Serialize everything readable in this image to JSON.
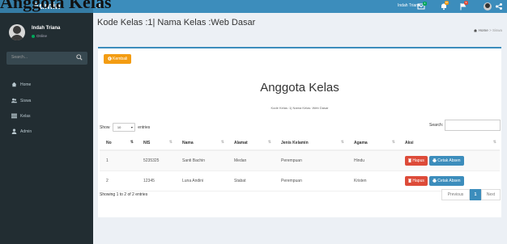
{
  "overlay_title": "Anggota Kelas",
  "sidebar": {
    "brand": "Admin",
    "user": {
      "name": "Indah Triana",
      "status": "Online"
    },
    "search": {
      "placeholder": "Search..."
    },
    "items": [
      {
        "label": "Home",
        "icon": "home-icon"
      },
      {
        "label": "Siswa",
        "icon": "users-icon"
      },
      {
        "label": "Kelas",
        "icon": "list-icon"
      },
      {
        "label": "Admin",
        "icon": "user-icon"
      }
    ]
  },
  "topbar": {
    "user_name": "Indah Triana",
    "icons": [
      "envelope-icon",
      "bell-icon",
      "flag-icon",
      "share-icon"
    ],
    "badges": {
      "envelope": "4",
      "bell": "10",
      "flag": "9"
    }
  },
  "header": {
    "title": "Kode Kelas :1| Nama Kelas :Web Dasar",
    "breadcrumb": [
      "Home",
      "Siswa"
    ]
  },
  "box": {
    "back_button": "Kembali",
    "title": "Anggota Kelas",
    "subtitle": "Kode Kelas :1| Nama Kelas :Web Dasar",
    "show_label": "Show",
    "entries_value": "10",
    "entries_label": "entries",
    "search_label": "Search:"
  },
  "table": {
    "columns": [
      "No",
      "NIS",
      "Nama",
      "Alamat",
      "Jenis Kelamin",
      "Agama",
      "Aksi"
    ],
    "rows": [
      {
        "no": "1",
        "nis": "5235325",
        "nama": "Santi Bachin",
        "alamat": "Medan",
        "jk": "Perempuan",
        "agama": "Hindu"
      },
      {
        "no": "2",
        "nis": "12345",
        "nama": "Luna Andini",
        "alamat": "Stabat",
        "jk": "Perempuan",
        "agama": "Kristen"
      }
    ],
    "action_delete": "Hapus",
    "action_print": "Cetak Absen"
  },
  "footer": {
    "info": "Showing 1 to 2 of 2 entries",
    "previous": "Previous",
    "page": "1",
    "next": "Next"
  },
  "colors": {
    "accent": "#3c8dbc",
    "sidebar": "#222d32",
    "warning": "#f39c12",
    "danger": "#dd4b39"
  }
}
